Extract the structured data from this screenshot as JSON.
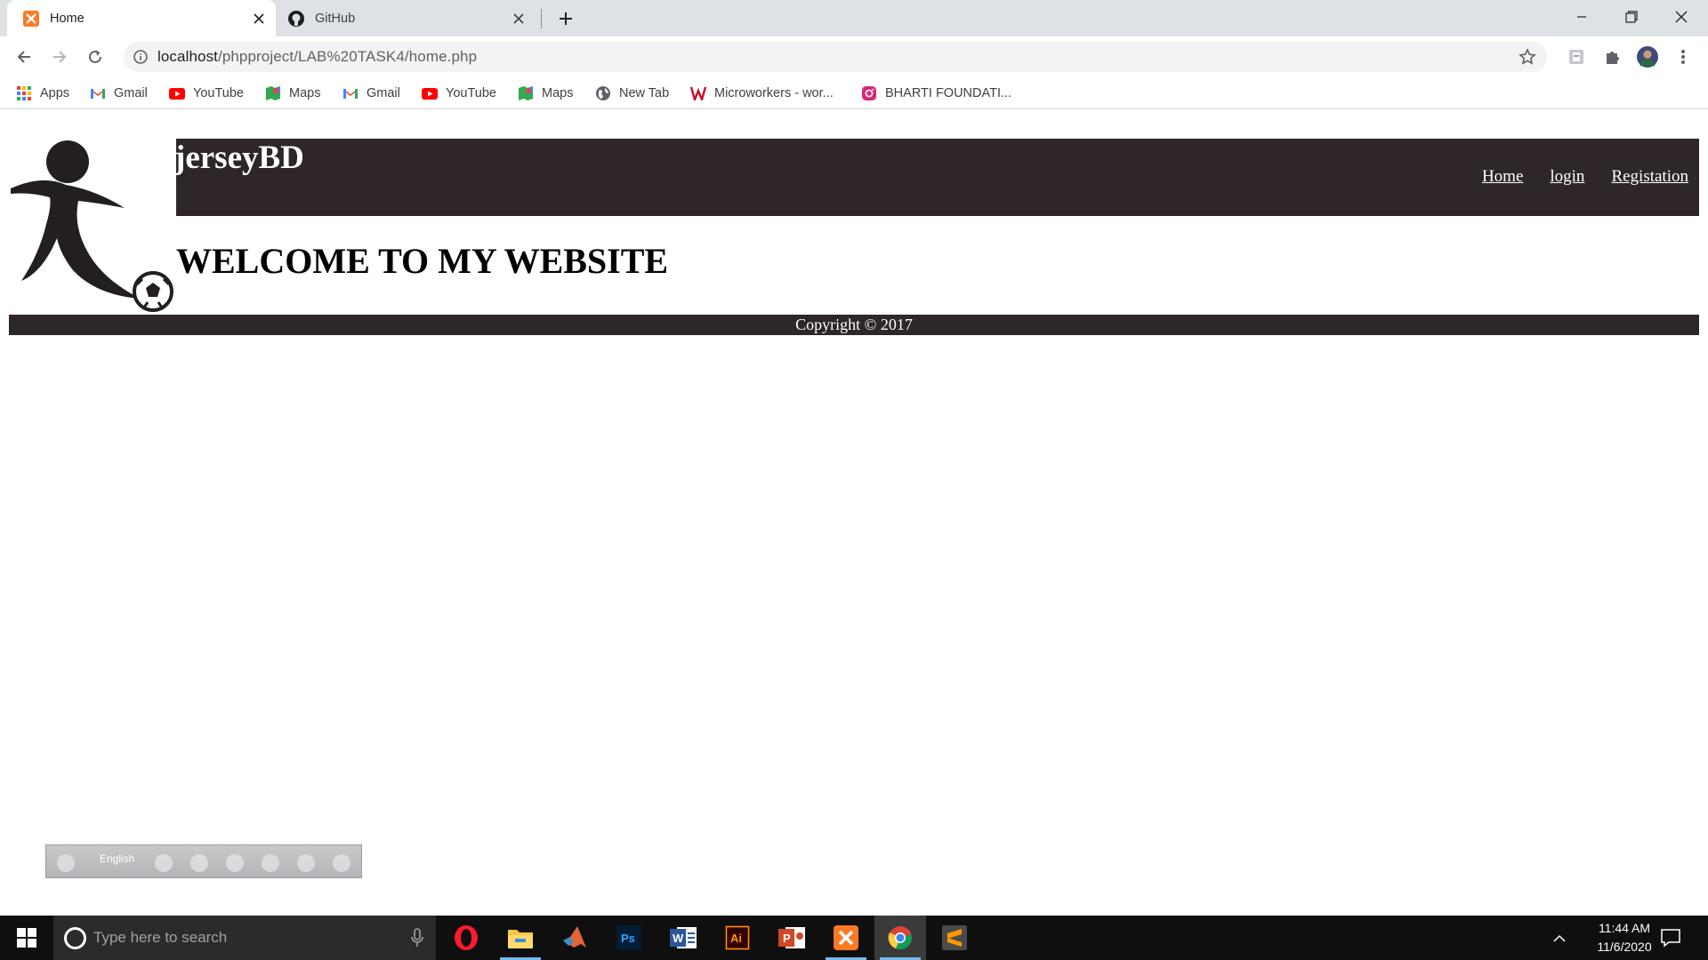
{
  "browser": {
    "tabs": [
      {
        "title": "Home",
        "icon": "xampp-icon",
        "active": true
      },
      {
        "title": "GitHub",
        "icon": "github-icon",
        "active": false
      }
    ],
    "url_host": "localhost",
    "url_path": "/phpproject/LAB%20TASK4/home.php",
    "bookmarks": [
      {
        "label": "Apps",
        "icon": "apps-grid-icon"
      },
      {
        "label": "Gmail",
        "icon": "gmail-icon"
      },
      {
        "label": "YouTube",
        "icon": "youtube-icon"
      },
      {
        "label": "Maps",
        "icon": "maps-icon"
      },
      {
        "label": "Gmail",
        "icon": "gmail-icon"
      },
      {
        "label": "YouTube",
        "icon": "youtube-icon"
      },
      {
        "label": "Maps",
        "icon": "maps-icon"
      },
      {
        "label": "New Tab",
        "icon": "globe-icon"
      },
      {
        "label": "Microworkers - wor...",
        "icon": "microworkers-icon"
      },
      {
        "label": "BHARTI FOUNDATI...",
        "icon": "instagram-icon"
      }
    ]
  },
  "site": {
    "title": "jerseyBD",
    "nav": [
      "Home",
      "login",
      "Registation"
    ],
    "welcome": "WELCOME TO MY WEBSITE",
    "footer": "Copyright © 2017"
  },
  "language_bar": {
    "language": "English"
  },
  "taskbar": {
    "search_placeholder": "Type here to search",
    "time": "11:44 AM",
    "date": "11/6/2020",
    "apps": [
      "opera-icon",
      "file-explorer-icon",
      "matlab-icon",
      "photoshop-icon",
      "word-icon",
      "illustrator-icon",
      "powerpoint-icon",
      "xampp-icon",
      "chrome-icon",
      "sublime-text-icon"
    ]
  },
  "colors": {
    "header_bg": "#2e2627",
    "tabstrip_bg": "#dee1e6",
    "taskbar_bg": "#0f0f10"
  }
}
